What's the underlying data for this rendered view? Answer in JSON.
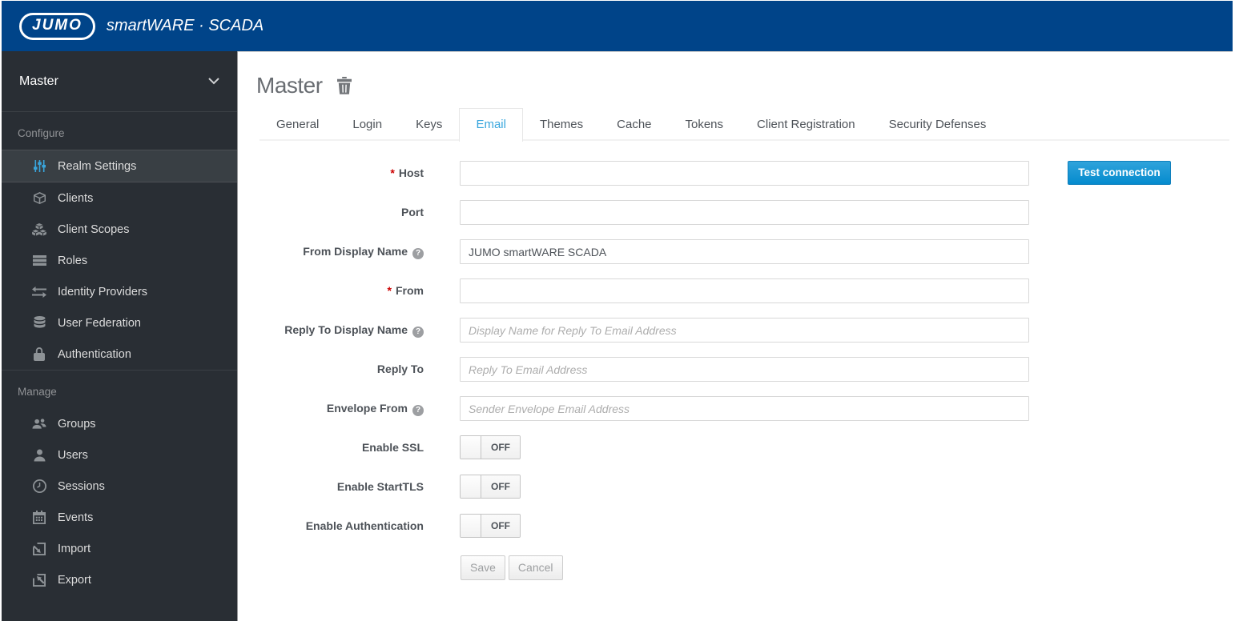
{
  "header": {
    "logo_text": "JUMO",
    "brand": "smartWARE · SCADA"
  },
  "sidebar": {
    "realm": "Master",
    "sections": [
      {
        "label": "Configure",
        "items": [
          {
            "label": "Realm Settings",
            "icon": "sliders-icon",
            "active": true
          },
          {
            "label": "Clients",
            "icon": "cube-icon"
          },
          {
            "label": "Client Scopes",
            "icon": "cubes-icon"
          },
          {
            "label": "Roles",
            "icon": "list-icon"
          },
          {
            "label": "Identity Providers",
            "icon": "exchange-icon"
          },
          {
            "label": "User Federation",
            "icon": "database-icon"
          },
          {
            "label": "Authentication",
            "icon": "lock-icon"
          }
        ]
      },
      {
        "label": "Manage",
        "items": [
          {
            "label": "Groups",
            "icon": "users-icon"
          },
          {
            "label": "Users",
            "icon": "user-icon"
          },
          {
            "label": "Sessions",
            "icon": "clock-icon"
          },
          {
            "label": "Events",
            "icon": "calendar-icon"
          },
          {
            "label": "Import",
            "icon": "import-icon"
          },
          {
            "label": "Export",
            "icon": "export-icon"
          }
        ]
      }
    ]
  },
  "main": {
    "title": "Master",
    "tabs": [
      {
        "label": "General"
      },
      {
        "label": "Login"
      },
      {
        "label": "Keys"
      },
      {
        "label": "Email",
        "active": true
      },
      {
        "label": "Themes"
      },
      {
        "label": "Cache"
      },
      {
        "label": "Tokens"
      },
      {
        "label": "Client Registration"
      },
      {
        "label": "Security Defenses"
      }
    ],
    "form": {
      "rows": [
        {
          "id": "host",
          "label": "Host",
          "required": true,
          "type": "text",
          "value": "",
          "placeholder": ""
        },
        {
          "id": "port",
          "label": "Port",
          "type": "text",
          "value": "",
          "placeholder": ""
        },
        {
          "id": "from-display-name",
          "label": "From Display Name",
          "help": true,
          "type": "text",
          "value": "JUMO smartWARE SCADA",
          "placeholder": ""
        },
        {
          "id": "from",
          "label": "From",
          "required": true,
          "type": "text",
          "value": "",
          "placeholder": ""
        },
        {
          "id": "reply-to-display-name",
          "label": "Reply To Display Name",
          "help": true,
          "type": "text",
          "value": "",
          "placeholder": "Display Name for Reply To Email Address"
        },
        {
          "id": "reply-to",
          "label": "Reply To",
          "type": "text",
          "value": "",
          "placeholder": "Reply To Email Address"
        },
        {
          "id": "envelope-from",
          "label": "Envelope From",
          "help": true,
          "type": "text",
          "value": "",
          "placeholder": "Sender Envelope Email Address"
        },
        {
          "id": "enable-ssl",
          "label": "Enable SSL",
          "type": "toggle",
          "state": "OFF"
        },
        {
          "id": "enable-starttls",
          "label": "Enable StartTLS",
          "type": "toggle",
          "state": "OFF"
        },
        {
          "id": "enable-authentication",
          "label": "Enable Authentication",
          "type": "toggle",
          "state": "OFF"
        }
      ],
      "test_button_label": "Test connection",
      "save_label": "Save",
      "cancel_label": "Cancel"
    }
  },
  "colors": {
    "header_bg": "#004489",
    "sidebar_bg": "#292e34",
    "active_item_bg": "#393f44",
    "accent_blue": "#39a5dc",
    "tab_active_color": "#39a6dd",
    "primary_btn_top": "#2fa3db",
    "primary_btn_bottom": "#058bce",
    "required_red": "#cc0000"
  }
}
